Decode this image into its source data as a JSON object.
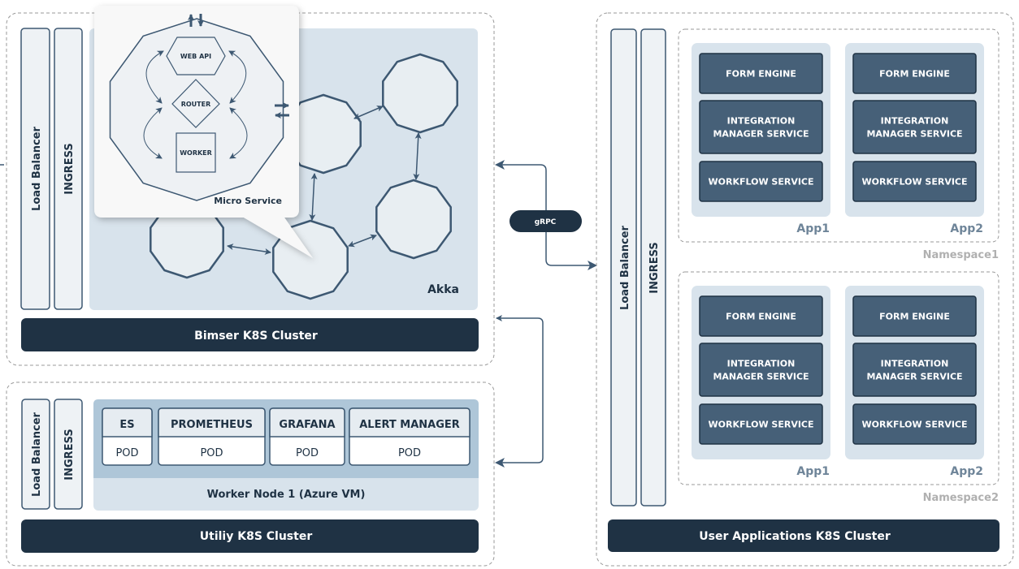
{
  "colors": {
    "dark_navy": "#1f3244",
    "service_box": "#466078",
    "stroke": "#3d5872",
    "light_panel": "#d8e3ec",
    "node_fill": "#e8eef2",
    "bar_fill": "#eef2f5",
    "pod_header": "#e6ecf1",
    "worker_band": "#aec6d8",
    "muted_label": "#6f8599",
    "namespace_label": "#b0b0b0"
  },
  "bimser_cluster": {
    "title": "Bimser K8S Cluster",
    "load_balancer": "Load Balancer",
    "ingress": "INGRESS",
    "akka_label": "Akka",
    "callout": {
      "title": "Micro Service",
      "web_api": "WEB API",
      "router": "ROUTER",
      "worker": "WORKER"
    }
  },
  "connector": {
    "label": "gRPC"
  },
  "utility_cluster": {
    "title": "Utiliy K8S Cluster",
    "load_balancer": "Load Balancer",
    "ingress": "INGRESS",
    "worker_node": "Worker Node 1 (Azure VM)",
    "pods": [
      {
        "name": "ES",
        "type": "POD"
      },
      {
        "name": "PROMETHEUS",
        "type": "POD"
      },
      {
        "name": "GRAFANA",
        "type": "POD"
      },
      {
        "name": "ALERT MANAGER",
        "type": "POD"
      }
    ]
  },
  "user_cluster": {
    "title": "User Applications K8S Cluster",
    "load_balancer": "Load Balancer",
    "ingress": "INGRESS",
    "namespaces": [
      {
        "name": "Namespace1",
        "apps": [
          {
            "name": "App1",
            "services": [
              "FORM ENGINE",
              "INTEGRATION|MANAGER SERVICE",
              "WORKFLOW SERVICE"
            ]
          },
          {
            "name": "App2",
            "services": [
              "FORM ENGINE",
              "INTEGRATION|MANAGER SERVICE",
              "WORKFLOW SERVICE"
            ]
          }
        ]
      },
      {
        "name": "Namespace2",
        "apps": [
          {
            "name": "App1",
            "services": [
              "FORM ENGINE",
              "INTEGRATION|MANAGER SERVICE",
              "WORKFLOW SERVICE"
            ]
          },
          {
            "name": "App2",
            "services": [
              "FORM ENGINE",
              "INTEGRATION|MANAGER SERVICE",
              "WORKFLOW SERVICE"
            ]
          }
        ]
      }
    ]
  }
}
